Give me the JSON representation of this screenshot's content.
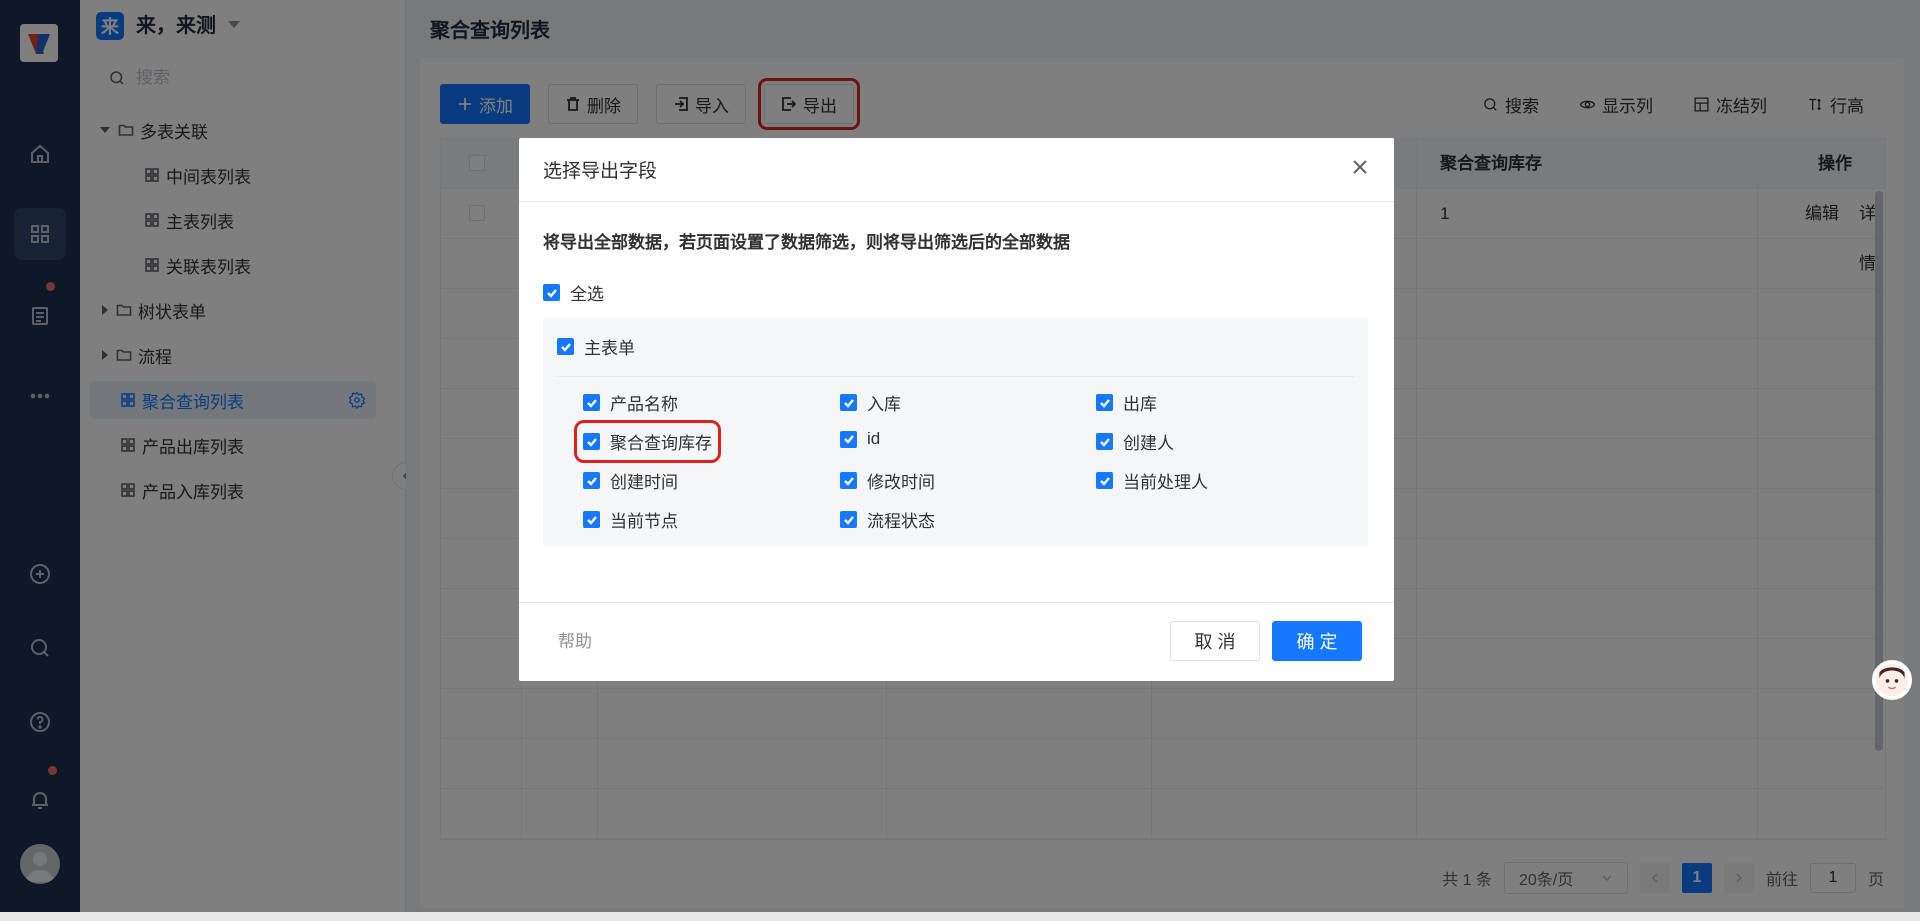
{
  "app": {
    "badge": "来",
    "title": "来，来测"
  },
  "sidebar": {
    "search_placeholder": "搜索",
    "items": [
      {
        "label": "多表关联"
      },
      {
        "label": "中间表列表"
      },
      {
        "label": "主表列表"
      },
      {
        "label": "关联表列表"
      },
      {
        "label": "树状表单"
      },
      {
        "label": "流程"
      },
      {
        "label": "聚合查询列表"
      },
      {
        "label": "产品出库列表"
      },
      {
        "label": "产品入库列表"
      }
    ]
  },
  "main": {
    "title": "聚合查询列表",
    "toolbar": {
      "add": "添加",
      "delete": "删除",
      "import": "导入",
      "export": "导出",
      "search": "搜索",
      "columns": "显示列",
      "freeze": "冻结列",
      "row_height": "行高"
    },
    "table": {
      "headers": [
        "聚合查询库存",
        "操作"
      ],
      "rows": [
        {
          "stock": "1",
          "edit": "编辑",
          "detail": "详情"
        }
      ]
    },
    "pager": {
      "total": "共 1 条",
      "page_size": "20条/页",
      "current_page": "1",
      "goto_label": "前往",
      "goto_value": "1",
      "goto_suffix": "页"
    }
  },
  "dialog": {
    "title": "选择导出字段",
    "note": "将导出全部数据，若页面设置了数据筛选，则将导出筛选后的全部数据",
    "select_all": "全选",
    "group_title": "主表单",
    "fields": [
      "产品名称",
      "入库",
      "出库",
      "聚合查询库存",
      "id",
      "创建人",
      "创建时间",
      "修改时间",
      "当前处理人",
      "当前节点",
      "流程状态"
    ],
    "help": "帮助",
    "cancel": "取 消",
    "confirm": "确 定"
  },
  "colors": {
    "primary": "#1677ff",
    "rail": "#1c3050",
    "highlight": "#e02020"
  }
}
